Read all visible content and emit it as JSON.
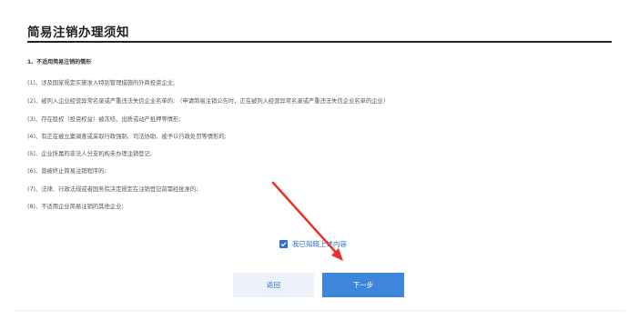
{
  "page": {
    "title": "简易注销办理须知"
  },
  "section": {
    "heading": "1、不适用简易注销的情形",
    "items": [
      "(1)、涉及国家规定实施准入特别管理措施的外商投资企业;",
      "(2)、被列入企业经营异常名录或严重违法失信企业名单的; （申请简易注销公告时，正在被列入经营异常名录或严重违法失信企业名单的企业）",
      "(3)、存在股权（投资权益）被冻结、出质或动产抵押等情形;",
      "(4)、有正在被立案调查或采取行政强制、司法协助、被予以行政处罚等情形的;",
      "(5)、企业所属的非法人分支机构未办理注销登记;",
      "(6)、曾被终止简易注销程序的;",
      "(7)、法律、行政法规或者国务院决定规定在注销登记前需经批准的;",
      "(8)、不适用企业简易注销的其他企业;"
    ]
  },
  "agree": {
    "label": "我已知晓上述内容",
    "checked": true
  },
  "buttons": {
    "back_label": "返回",
    "next_label": "下一步"
  },
  "colors": {
    "accent": "#2f6fd1",
    "annotation_arrow": "#e8332a"
  },
  "icons": {
    "checkbox": "checkmark-icon",
    "annotation": "red-arrow-annotation"
  }
}
